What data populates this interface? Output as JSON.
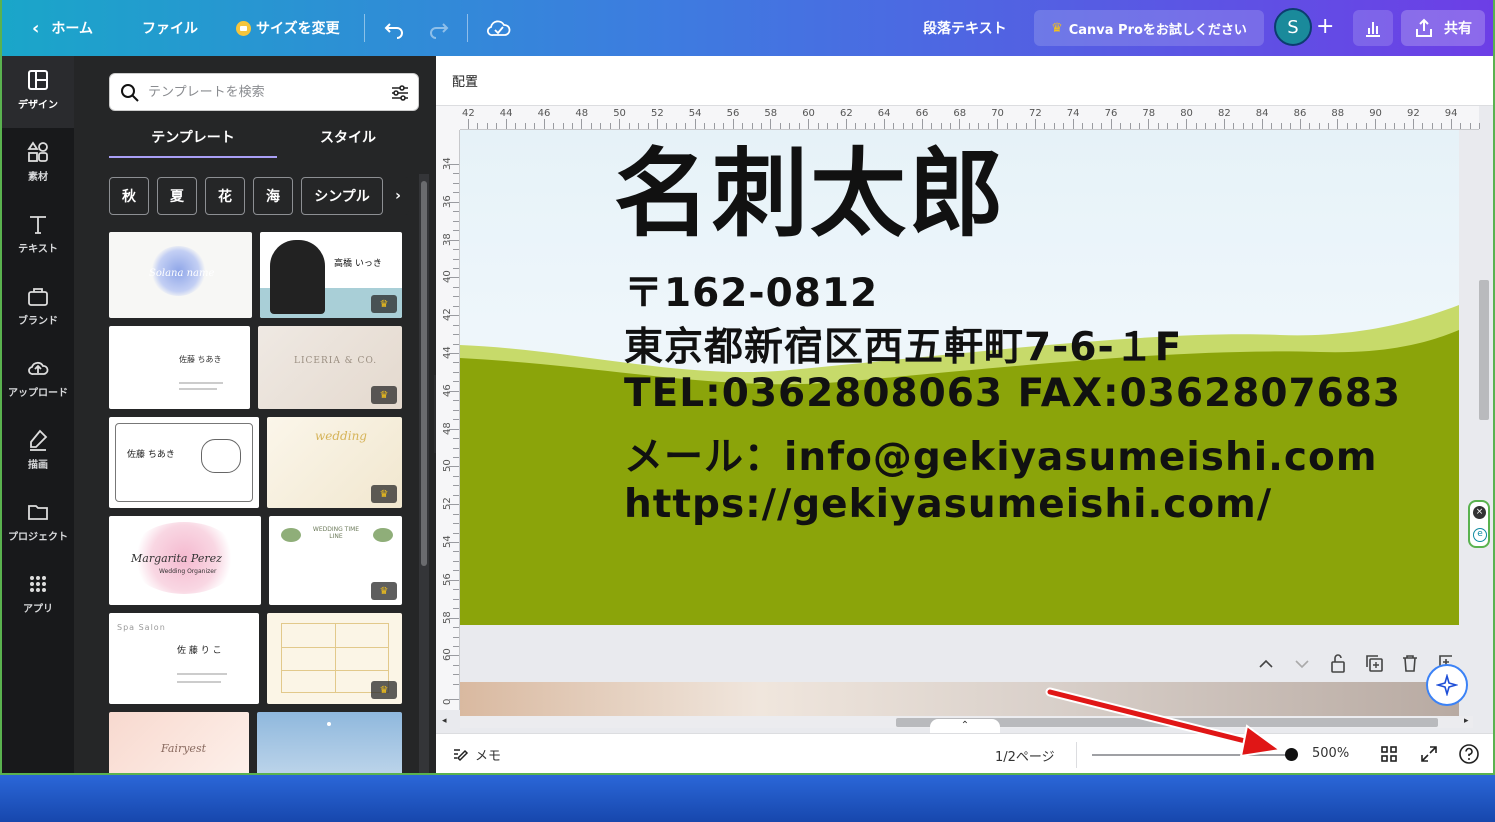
{
  "topbar": {
    "home": "ホーム",
    "file": "ファイル",
    "resize": "サイズを変更",
    "element_type": "段落テキスト",
    "pro": "Canva Proをお試しください",
    "avatar": "S",
    "share": "共有"
  },
  "rail": [
    {
      "label": "デザイン"
    },
    {
      "label": "素材"
    },
    {
      "label": "テキスト"
    },
    {
      "label": "ブランド"
    },
    {
      "label": "アップロード"
    },
    {
      "label": "描画"
    },
    {
      "label": "プロジェクト"
    },
    {
      "label": "アプリ"
    }
  ],
  "panel": {
    "search_placeholder": "テンプレートを検索",
    "tab_templates": "テンプレート",
    "tab_styles": "スタイル",
    "chips": [
      "秋",
      "夏",
      "花",
      "海",
      "シンプル"
    ]
  },
  "thumbs": {
    "t1": "Solana name",
    "t2_name": "高橋 いっき",
    "t3_name": "佐藤 ちあき",
    "t4": "LICERIA & CO.",
    "t5_name": "佐藤 ちあき",
    "t6": "wedding",
    "t7": "Margarita Perez",
    "t7b": "Wedding Organizer",
    "t8": "WEDDING TIME LINE",
    "t9": "Spa Salon",
    "t9_name": "佐 藤 り こ",
    "t11": "Fairyest"
  },
  "toolbar": {
    "label": "配置"
  },
  "ruler": {
    "h": [
      "42",
      "44",
      "46",
      "48",
      "50",
      "52",
      "54",
      "56",
      "58",
      "60",
      "62",
      "64",
      "66",
      "68",
      "70",
      "72",
      "74",
      "76",
      "78",
      "80",
      "82",
      "84",
      "86",
      "88",
      "90",
      "92",
      "94"
    ],
    "v": [
      "34",
      "36",
      "38",
      "40",
      "42",
      "44",
      "46",
      "48",
      "50",
      "52",
      "54",
      "56",
      "58",
      "60",
      "0"
    ]
  },
  "card": {
    "name": "名刺太郎",
    "lines": [
      "〒162-0812",
      "東京都新宿区西五軒町7-6-１F",
      "TEL:0362808063 FAX:0362807683",
      "メール：info@gekiyasumeishi.com",
      "https://gekiyasumeishi.com/"
    ]
  },
  "footer": {
    "notes": "メモ",
    "pages": "1/2ページ",
    "zoom": "500%"
  },
  "colors": {
    "accent": "#8b5cf6",
    "canvas_green": "#8ba40a",
    "arrow": "#e01616"
  }
}
